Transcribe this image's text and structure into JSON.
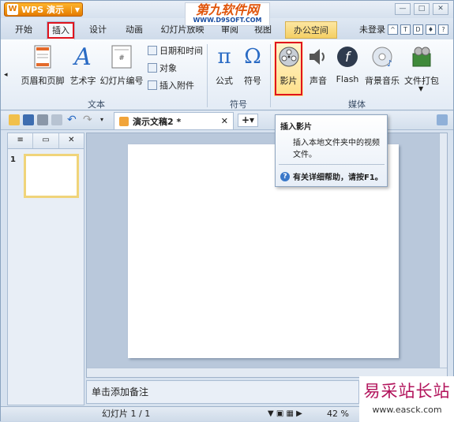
{
  "app": {
    "button_label": "WPS 演示"
  },
  "watermark_top": {
    "line1": "第九软件网",
    "line2": "WWW.D9SOFT.COM"
  },
  "tabs": [
    "开始",
    "插入",
    "设计",
    "动画",
    "幻灯片放映",
    "审阅",
    "视图"
  ],
  "office_tab": "办公空间",
  "login": "未登录",
  "ribbon": {
    "text_group": {
      "label": "文本",
      "buttons": [
        "页眉和页脚",
        "艺术字",
        "幻灯片编号"
      ],
      "small": [
        "日期和时间",
        "对象",
        "插入附件"
      ]
    },
    "symbol_group": {
      "label": "符号",
      "buttons": [
        "公式",
        "符号"
      ]
    },
    "media_group": {
      "label": "媒体",
      "buttons": [
        "影片",
        "声音",
        "Flash",
        "背景音乐",
        "文件打包"
      ]
    }
  },
  "doc_tab": "演示文稿2 *",
  "tooltip": {
    "title": "插入影片",
    "desc": "插入本地文件夹中的视频文件。",
    "help": "有关详细帮助，请按F1。"
  },
  "slides": {
    "number": "1"
  },
  "notes_placeholder": "单击添加备注",
  "status": {
    "slide_info": "幻灯片 1 / 1",
    "zoom": "42 %"
  },
  "watermark_bottom": {
    "line1": "易采站长站",
    "line2": "www.easck.com"
  },
  "colors": {
    "highlight": "#e0141e",
    "accent": "#e47b00"
  }
}
